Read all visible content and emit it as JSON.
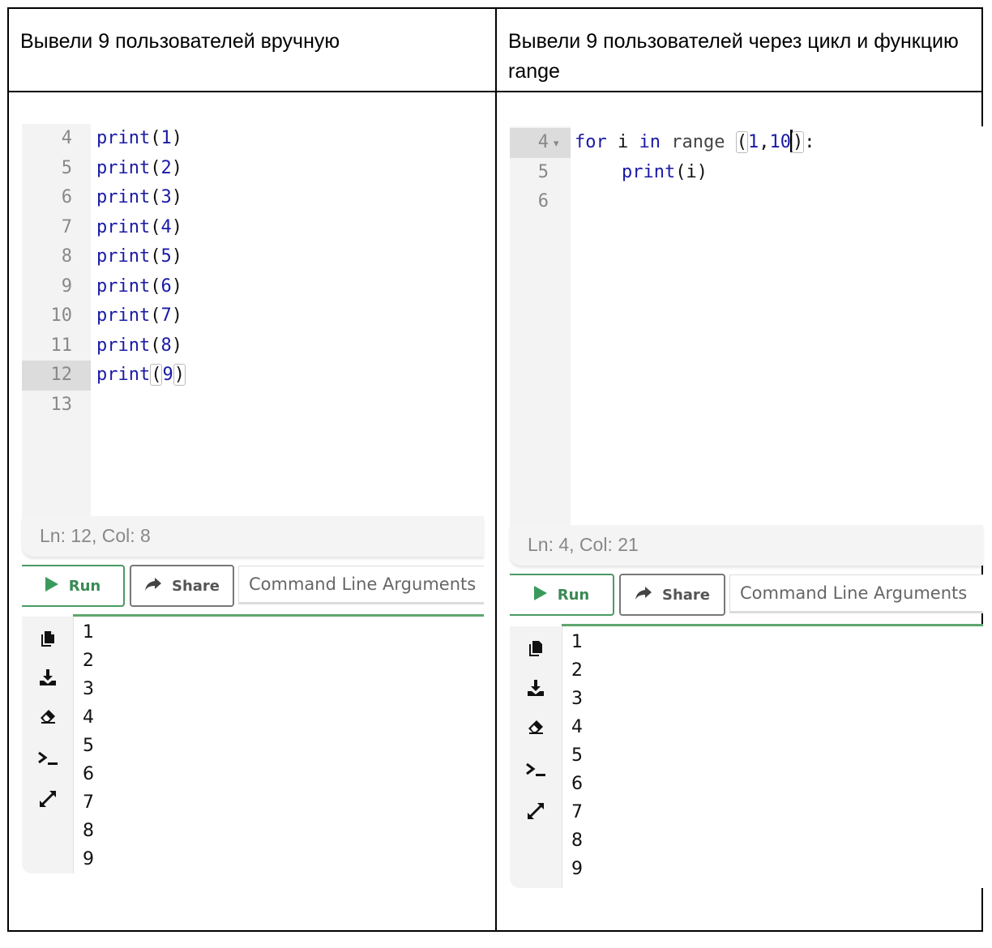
{
  "table": {
    "left_header": "Вывели 9 пользователей вручную",
    "right_header": "Вывели 9 пользователей через цикл и функцию range"
  },
  "left": {
    "editor": {
      "lines": [
        {
          "num": "4",
          "fn": "print",
          "arg": "1"
        },
        {
          "num": "5",
          "fn": "print",
          "arg": "2"
        },
        {
          "num": "6",
          "fn": "print",
          "arg": "3"
        },
        {
          "num": "7",
          "fn": "print",
          "arg": "4"
        },
        {
          "num": "8",
          "fn": "print",
          "arg": "5"
        },
        {
          "num": "9",
          "fn": "print",
          "arg": "6"
        },
        {
          "num": "10",
          "fn": "print",
          "arg": "7"
        },
        {
          "num": "11",
          "fn": "print",
          "arg": "8"
        },
        {
          "num": "12",
          "fn": "print",
          "arg": "9",
          "active": true
        },
        {
          "num": "13",
          "fn": "",
          "arg": ""
        }
      ]
    },
    "status": "Ln: 12,  Col: 8",
    "run_label": "Run",
    "share_label": "Share",
    "cla_placeholder": "Command Line Arguments",
    "output": [
      "1",
      "2",
      "3",
      "4",
      "5",
      "6",
      "7",
      "8",
      "9"
    ]
  },
  "right": {
    "editor": {
      "line1": {
        "num": "4",
        "kw_for": "for",
        "var": "i",
        "kw_in": "in",
        "builtin": "range",
        "arg1": "1",
        "arg2": "10",
        "colon": ":"
      },
      "line2": {
        "num": "5",
        "fn": "print",
        "arg": "i"
      },
      "line3": {
        "num": "6"
      }
    },
    "status": "Ln: 4,  Col: 21",
    "run_label": "Run",
    "share_label": "Share",
    "cla_placeholder": "Command Line Arguments",
    "output": [
      "1",
      "2",
      "3",
      "4",
      "5",
      "6",
      "7",
      "8",
      "9"
    ]
  },
  "console_icons": [
    "copy-icon",
    "download-icon",
    "eraser-icon",
    "terminal-icon",
    "expand-icon"
  ],
  "colors": {
    "run_green": "#3a8a55",
    "keyword_blue": "#1a1aa6",
    "gutter_bg": "#f3f3f3",
    "active_line_bg": "#dcdcdc"
  }
}
